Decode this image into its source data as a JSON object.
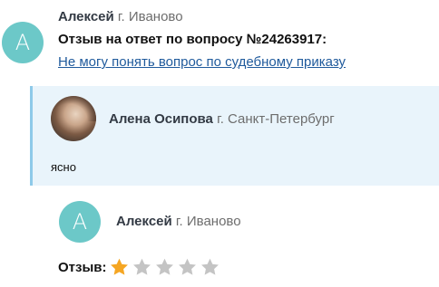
{
  "review": {
    "author_initial": "А",
    "author_name": "Алексей",
    "author_city": "г. Иваново",
    "title": "Отзыв на ответ по вопросу №24263917:",
    "question_link": "Не могу понять вопрос по судебному приказу"
  },
  "answer": {
    "author_name": "Алена Осипова",
    "author_city": "г. Санкт-Петербург",
    "text": "ясно"
  },
  "reviewer": {
    "author_initial": "А",
    "author_name": "Алексей",
    "author_city": "г. Иваново"
  },
  "rating": {
    "label": "Отзыв:",
    "value": 1,
    "max": 5,
    "filled_color": "#f5a623",
    "empty_color": "#c4c4c4"
  },
  "colors": {
    "avatar_bg": "#6cc8c8",
    "link": "#1f5a9c",
    "answer_bg": "#e9f4fb",
    "answer_border": "#8ecae9"
  }
}
